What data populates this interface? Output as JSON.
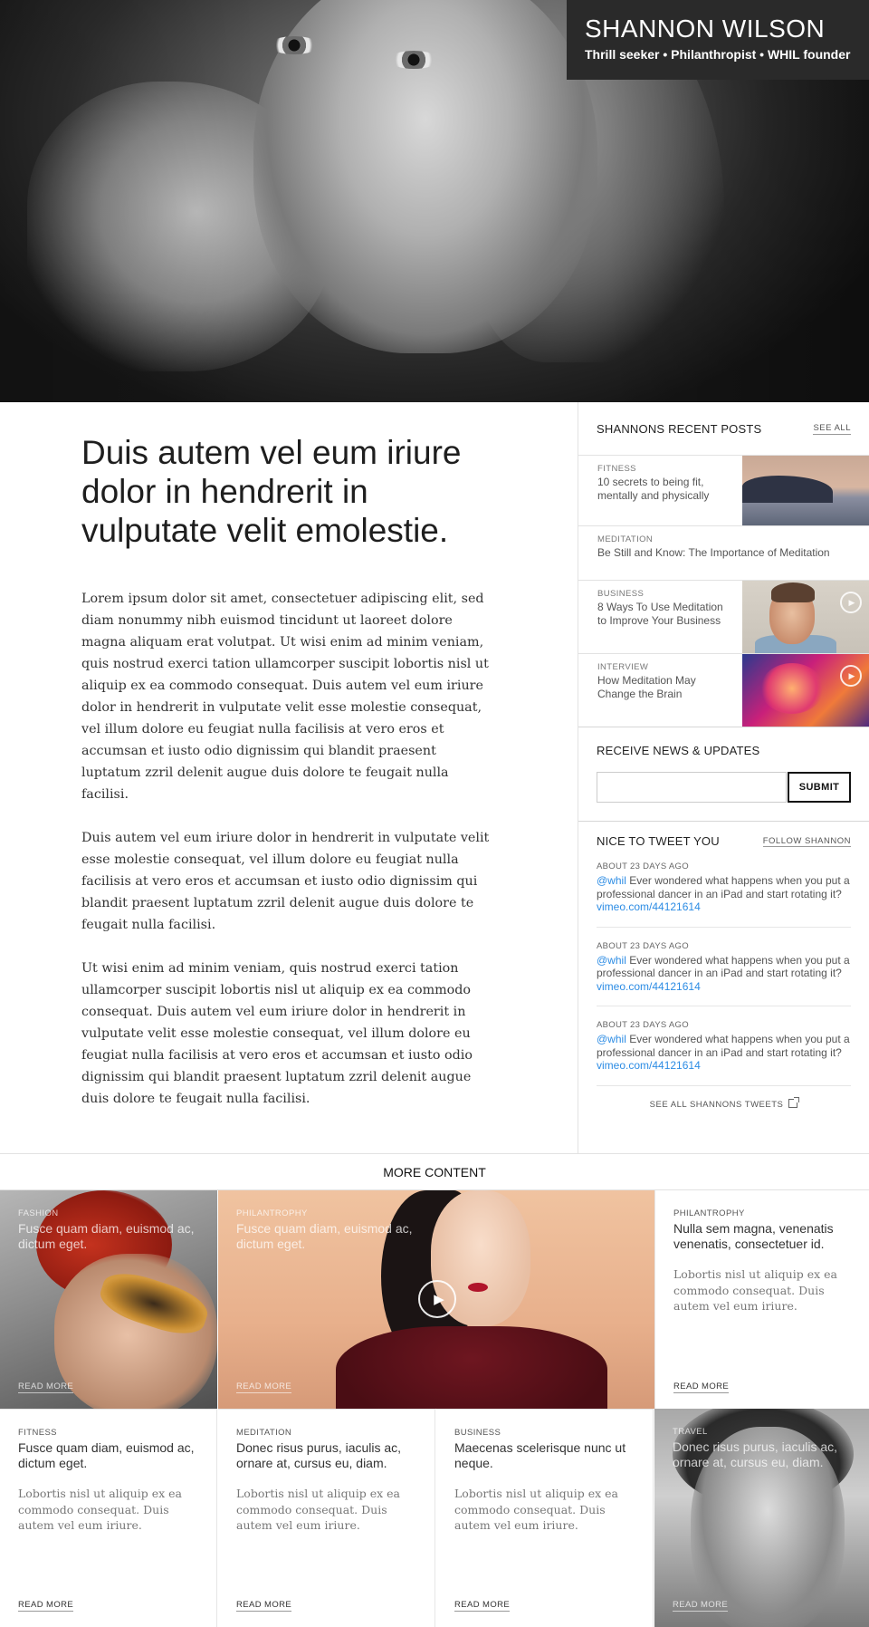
{
  "hero": {
    "name": "SHANNON WILSON",
    "tagline": "Thrill seeker • Philanthropist • WHIL founder"
  },
  "article": {
    "headline": "Duis autem vel eum iriure dolor in hendrerit in vulputate velit emolestie.",
    "paragraphs": [
      "Lorem ipsum dolor sit amet, consectetuer adipiscing elit, sed diam nonummy nibh euismod tincidunt ut laoreet dolore magna aliquam erat volutpat. Ut wisi enim ad minim veniam, quis nostrud exerci tation ullamcorper suscipit lobortis nisl ut aliquip ex ea commodo consequat. Duis autem vel eum iriure dolor in hendrerit in vulputate velit esse molestie consequat, vel illum dolore eu feugiat nulla facilisis at vero eros et accumsan et iusto odio dignissim qui blandit praesent luptatum zzril delenit augue duis dolore te feugait nulla facilisi.",
      "Duis autem vel eum iriure dolor in hendrerit in vulputate velit esse molestie consequat, vel illum dolore eu feugiat nulla facilisis at vero eros et accumsan et iusto odio dignissim qui blandit praesent luptatum zzril delenit augue duis dolore te feugait nulla facilisi.",
      "Ut wisi enim ad minim veniam, quis nostrud exerci tation ullamcorper suscipit lobortis nisl ut aliquip ex ea commodo consequat. Duis autem vel eum iriure dolor in hendrerit in vulputate velit esse molestie consequat, vel illum dolore eu feugiat nulla facilisis at vero eros et accumsan et iusto odio dignissim qui blandit praesent luptatum zzril delenit augue duis dolore te feugait nulla facilisi."
    ]
  },
  "sidebar": {
    "recent_title": "SHANNONS RECENT POSTS",
    "see_all": "SEE ALL",
    "posts": [
      {
        "category": "FITNESS",
        "title": "10 secrets to being fit, mentally and physically"
      },
      {
        "category": "MEDITATION",
        "title": "Be Still and Know: The Importance of Meditation"
      },
      {
        "category": "BUSINESS",
        "title": "8 Ways To Use Meditation to Improve Your Business"
      },
      {
        "category": "INTERVIEW",
        "title": "How Meditation May Change the Brain"
      }
    ],
    "news_title": "RECEIVE NEWS & UPDATES",
    "email_placeholder": "",
    "submit_label": "SUBMIT",
    "tweet_title": "NICE TO TWEET YOU",
    "follow_label": "FOLLOW SHANNON",
    "tweets": [
      {
        "when": "ABOUT 23 DAYS AGO",
        "handle": "@whil",
        "text": " Ever wondered what happens when you put a professional dancer in an iPad and start rotating it? ",
        "link": "vimeo.com/44121614"
      },
      {
        "when": "ABOUT 23 DAYS AGO",
        "handle": "@whil",
        "text": " Ever wondered what happens when you put a professional dancer in an iPad and start rotating it? ",
        "link": "vimeo.com/44121614"
      },
      {
        "when": "ABOUT 23 DAYS AGO",
        "handle": "@whil",
        "text": " Ever wondered what happens when you put a professional dancer in an iPad and start rotating it? ",
        "link": "vimeo.com/44121614"
      }
    ],
    "see_all_tweets": "SEE ALL SHANNONS TWEETS"
  },
  "more": {
    "title": "MORE CONTENT",
    "tiles": [
      {
        "category": "FASHION",
        "title": "Fusce quam diam, euismod ac, dictum eget.",
        "read_more": "READ MORE"
      },
      {
        "category": "PHILANTROPHY",
        "title": "Fusce quam diam, euismod ac, dictum eget.",
        "read_more": "READ MORE"
      },
      {
        "category": "PHILANTROPHY",
        "title": "Nulla sem magna, venenatis venenatis, consectetuer id.",
        "desc": "Lobortis nisl ut aliquip ex ea commodo consequat. Duis autem vel eum iriure.",
        "read_more": "READ MORE"
      },
      {
        "category": "FITNESS",
        "title": "Fusce quam diam, euismod ac, dictum eget.",
        "desc": "Lobortis nisl ut aliquip ex ea commodo consequat. Duis autem vel eum iriure.",
        "read_more": "READ MORE"
      },
      {
        "category": "MEDITATION",
        "title": "Donec risus purus, iaculis ac, ornare at, cursus eu, diam.",
        "desc": "Lobortis nisl ut aliquip ex ea commodo consequat. Duis autem vel eum iriure.",
        "read_more": "READ MORE"
      },
      {
        "category": "BUSINESS",
        "title": "Maecenas scelerisque nunc ut neque.",
        "desc": "Lobortis nisl ut aliquip ex ea commodo consequat. Duis autem vel eum iriure.",
        "read_more": "READ MORE"
      },
      {
        "category": "TRAVEL",
        "title": "Donec risus purus, iaculis ac, ornare at, cursus eu, diam.",
        "read_more": "READ MORE"
      }
    ]
  },
  "colors": {
    "link_blue": "#2c8ce4",
    "namecard_bg": "#2a2a2a"
  },
  "icons": [
    "play-icon",
    "external-link-icon"
  ]
}
